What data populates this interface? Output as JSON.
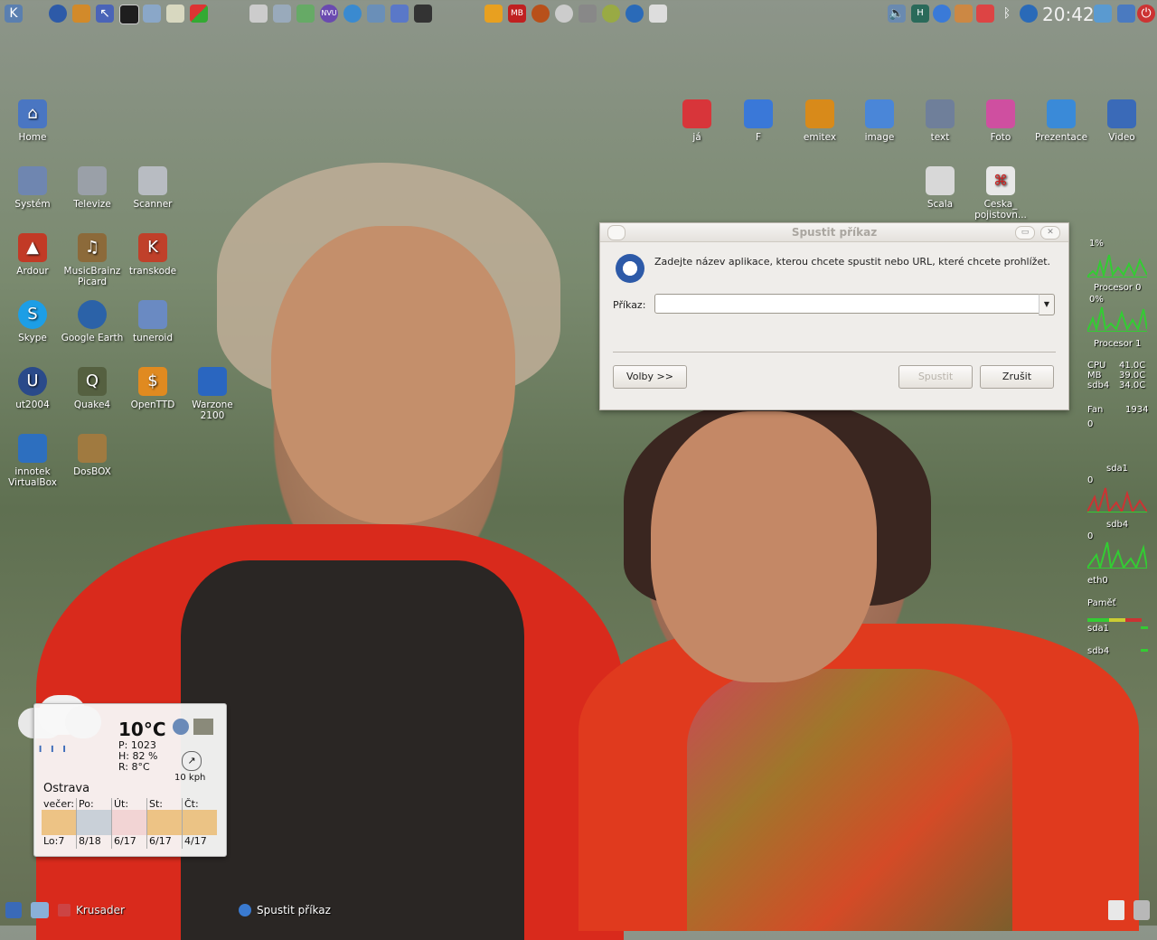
{
  "top_panel": {
    "clock": "20:42",
    "launchers": [
      "kde-menu-icon",
      "globe-icon",
      "firefox-icon",
      "cursor-icon",
      "terminal-icon",
      "window-icon",
      "notes-icon",
      "windows-icon"
    ],
    "tray": [
      "camera-icon",
      "news-icon",
      "spreadsheet-icon",
      "nvu-icon",
      "network-icon",
      "satellite-icon",
      "pen-icon",
      "headphones-icon",
      "mb-icon",
      "rugby-icon",
      "cd-icon",
      "bug-icon",
      "sync-icon",
      "wheel-icon",
      "blank-icon"
    ],
    "right_tray": [
      "volume-icon",
      "keyboard-layout-icon",
      "disk-icon",
      "paint-icon",
      "kmail-icon",
      "bluetooth-icon",
      "kde-circle-icon"
    ],
    "keyboard_label": "H"
  },
  "desktop_icons_left": [
    {
      "label": "Home",
      "icon": "home-icon",
      "color": "#4a76c2"
    },
    {
      "label": "Systém",
      "icon": "computer-icon",
      "color": "#6f86b0"
    },
    {
      "label": "Televize",
      "icon": "tv-icon",
      "color": "#9aa0a8"
    },
    {
      "label": "Scanner",
      "icon": "scanner-icon",
      "color": "#b8bcc2"
    },
    {
      "label": "Ardour",
      "icon": "ardour-icon",
      "color": "#c23a26"
    },
    {
      "label": "MusicBrainz Picard",
      "icon": "musicbrainz-icon",
      "color": "#8c6a3a"
    },
    {
      "label": "transkode",
      "icon": "transkode-icon",
      "color": "#c0402a"
    },
    {
      "label": "Skype",
      "icon": "skype-icon",
      "color": "#1d9ee6"
    },
    {
      "label": "Google Earth",
      "icon": "earth-icon",
      "color": "#2b62a8"
    },
    {
      "label": "tuneroid",
      "icon": "tuneroid-icon",
      "color": "#6a8ac2"
    },
    {
      "label": "ut2004",
      "icon": "ut2004-icon",
      "color": "#2a4a8a"
    },
    {
      "label": "Quake4",
      "icon": "quake-icon",
      "color": "#556040"
    },
    {
      "label": "OpenTTD",
      "icon": "openttd-icon",
      "color": "#e08a20"
    },
    {
      "label": "Warzone 2100",
      "icon": "warzone-icon",
      "color": "#2a66c0"
    },
    {
      "label": "innotek VirtualBox",
      "icon": "virtualbox-icon",
      "color": "#2d6fbf"
    },
    {
      "label": "DosBOX",
      "icon": "dosbox-icon",
      "color": "#a07a40"
    }
  ],
  "desktop_icons_right": [
    {
      "label": "já",
      "icon": "folder-red-icon",
      "color": "#d8353a"
    },
    {
      "label": "F",
      "icon": "folder-blue-icon",
      "color": "#3a78d8"
    },
    {
      "label": "emitex",
      "icon": "folder-orange-icon",
      "color": "#d88a1a"
    },
    {
      "label": "image",
      "icon": "folder-blue-icon",
      "color": "#4a86d8"
    },
    {
      "label": "text",
      "icon": "folder-text-icon",
      "color": "#6f7f9a"
    },
    {
      "label": "Foto",
      "icon": "folder-photo-icon",
      "color": "#cf4fa0"
    },
    {
      "label": "Prezentace",
      "icon": "folder-presentation-icon",
      "color": "#3a8ad8"
    },
    {
      "label": "Video",
      "icon": "folder-video-icon",
      "color": "#3a6ab8"
    },
    {
      "label": "Scala",
      "icon": "document-icon",
      "color": "#d8d8d8"
    },
    {
      "label": "Ceska_ pojistovn...",
      "icon": "pdf-icon",
      "color": "#e8e8e8"
    }
  ],
  "dialog": {
    "title": "Spustit příkaz",
    "prompt": "Zadejte název aplikace, kterou chcete spustit nebo URL, které chcete prohlížet.",
    "command_label": "Příkaz:",
    "command_value": "",
    "options_button": "Volby >>",
    "run_button": "Spustit",
    "cancel_button": "Zrušit"
  },
  "weather": {
    "temperature": "10°C",
    "pressure": "P: 1023",
    "humidity": "H: 82 %",
    "real_feel": "R: 8°C",
    "wind": "10 kph",
    "city": "Ostrava",
    "forecast": [
      {
        "day": "večer:",
        "temp": "Lo:7"
      },
      {
        "day": "Po:",
        "temp": "8/18"
      },
      {
        "day": "Út:",
        "temp": "6/17"
      },
      {
        "day": "St:",
        "temp": "6/17"
      },
      {
        "day": "Čt:",
        "temp": "4/17"
      }
    ]
  },
  "sysmon": {
    "cpu0_pct": "1%",
    "cpu0_label": "Procesor 0",
    "cpu1_pct": "0%",
    "cpu1_label": "Procesor 1",
    "temps": [
      {
        "label": "CPU",
        "value": "41.0C"
      },
      {
        "label": "MB",
        "value": "39.0C"
      },
      {
        "label": "sdb4",
        "value": "34.0C"
      }
    ],
    "fan_label": "Fan",
    "fan_value": "1934",
    "fan_zero": "0",
    "sda1_label": "sda1",
    "sda1_zero": "0",
    "sdb4_label": "sdb4",
    "sdb4_zero": "0",
    "eth_label": "eth0",
    "mem_label": "Paměť",
    "disk1_label": "sda1",
    "disk2_label": "sdb4"
  },
  "bottom_panel": {
    "task1": "Krusader",
    "task2": "Spustit příkaz"
  }
}
